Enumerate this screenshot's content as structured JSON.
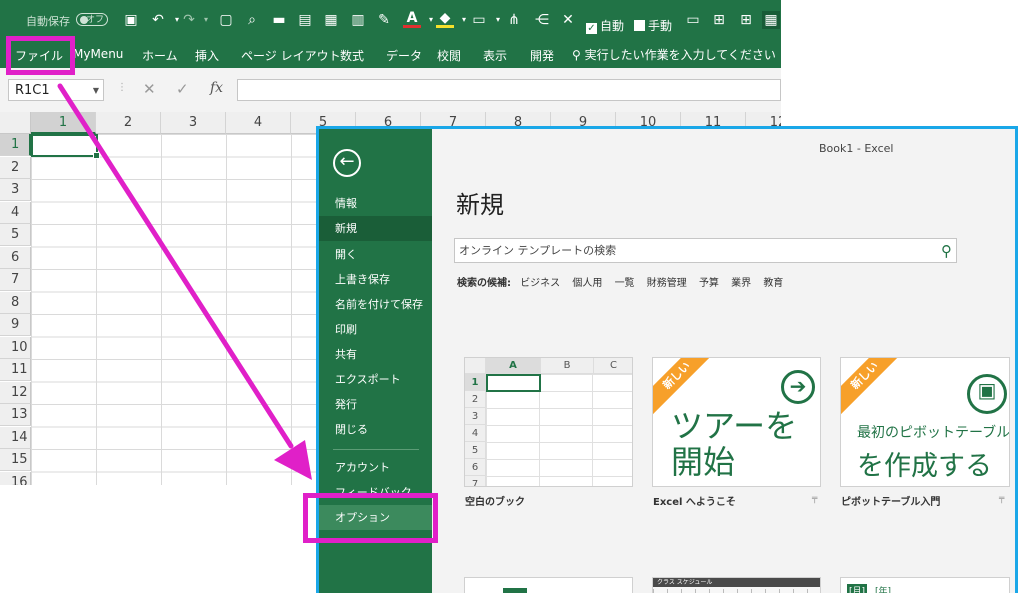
{
  "qat": {
    "autosave_label": "自動保存",
    "autosave_state": "オフ",
    "auto_label": "自動",
    "manual_label": "手動",
    "check_mark": "✓",
    "icons": [
      "save-icon",
      "undo-icon",
      "redo-icon",
      "new-icon",
      "print-preview-icon",
      "open-icon",
      "picture-icon",
      "calculator-icon",
      "form-icon",
      "format-painter-icon",
      "font-color-icon",
      "fill-color-icon",
      "borders-icon",
      "trace-precedents-icon",
      "trace-dependents-icon",
      "remove-arrows-icon"
    ]
  },
  "ribbon": {
    "tabs": [
      "ファイル",
      "MyMenu",
      "ホーム",
      "挿入",
      "ページ レイアウト",
      "数式",
      "データ",
      "校閲",
      "表示",
      "開発"
    ],
    "tell_me": "実行したい作業を入力してください"
  },
  "formula_bar": {
    "name_box": "R1C1",
    "fx_label": "fx",
    "formula": ""
  },
  "sheet": {
    "columns": [
      "1",
      "2",
      "3",
      "4",
      "5",
      "6",
      "7",
      "8",
      "9",
      "10",
      "11",
      "12"
    ],
    "rows": [
      "1",
      "2",
      "3",
      "4",
      "5",
      "6",
      "7",
      "8",
      "9",
      "10",
      "11",
      "12",
      "13",
      "14",
      "15",
      "16"
    ]
  },
  "backstage": {
    "window_title": "Book1  -  Excel",
    "title": "新規",
    "back_icon": "←",
    "nav": [
      "情報",
      "新規",
      "開く",
      "上書き保存",
      "名前を付けて保存",
      "印刷",
      "共有",
      "エクスポート",
      "発行",
      "閉じる"
    ],
    "nav_bottom": [
      "アカウント",
      "フィードバック",
      "オプション"
    ],
    "active_nav": "新規",
    "search_placeholder": "オンライン テンプレートの検索",
    "suggest_label": "検索の候補:",
    "suggestions": [
      "ビジネス",
      "個人用",
      "一覧",
      "財務管理",
      "予算",
      "業界",
      "教育"
    ],
    "templates": [
      {
        "name": "空白のブック",
        "columns": [
          "A",
          "B",
          "C"
        ],
        "rows": [
          "1",
          "2",
          "3",
          "4",
          "5",
          "6",
          "7"
        ]
      },
      {
        "name": "Excel へようこそ",
        "badge": "新しい",
        "line1": "ツアーを",
        "line2": "開始"
      },
      {
        "name": "ピボットテーブル入門",
        "badge": "新しい",
        "line1": "最初のピボットテーブル",
        "line2": "を作成する"
      }
    ],
    "row2_labels": [
      "クラス スケジュール",
      "[月]",
      "[年]"
    ]
  },
  "colors": {
    "excel_green": "#217346",
    "highlight": "#e020c8",
    "backstage_border": "#1aa7e8",
    "badge": "#f7a02a"
  }
}
